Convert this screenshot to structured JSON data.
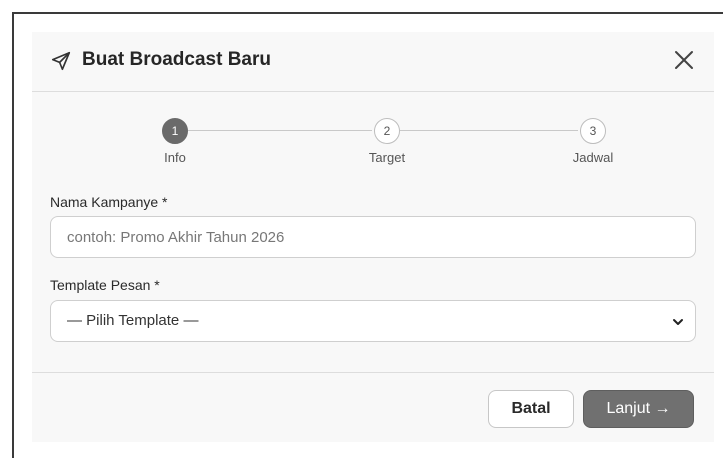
{
  "modal": {
    "title": "Buat Broadcast Baru",
    "title_icon": "send-icon",
    "close_icon": "close-icon"
  },
  "stepper": {
    "steps": [
      {
        "number": "1",
        "label": "Info",
        "state": "active"
      },
      {
        "number": "2",
        "label": "Target",
        "state": "inactive"
      },
      {
        "number": "3",
        "label": "Jadwal",
        "state": "inactive"
      }
    ]
  },
  "form": {
    "campaign_name": {
      "label": "Nama Kampanye *",
      "placeholder": "contoh: Promo Akhir Tahun 2026",
      "value": ""
    },
    "template": {
      "label": "Template Pesan *",
      "selected": "— Pilih Template —",
      "icon": "chevron-down-icon"
    }
  },
  "footer": {
    "cancel_label": "Batal",
    "next_label": "Lanjut →"
  },
  "colors": {
    "active_step": "#6a6a6a",
    "primary_button": "#707070",
    "border": "#cfcfcf"
  }
}
